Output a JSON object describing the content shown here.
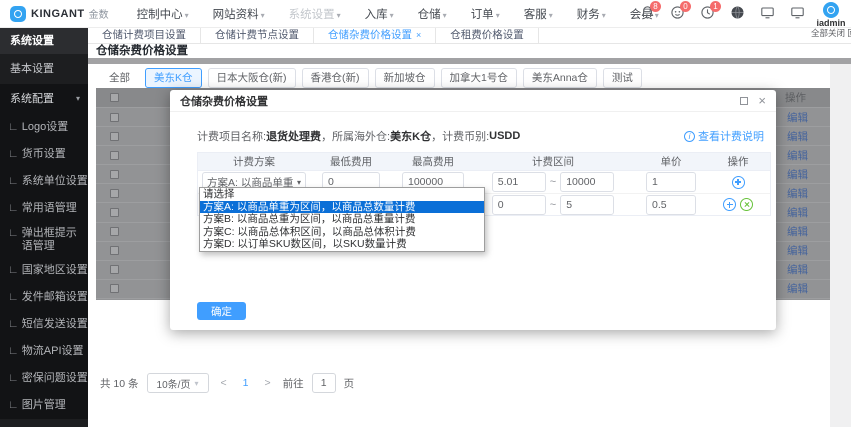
{
  "navbar": {
    "brand_name": "KINGANT",
    "brand_suffix": "金数",
    "menus": [
      "控制中心",
      "网站资料",
      "系统设置",
      "入库",
      "仓储",
      "订单",
      "客服",
      "财务",
      "会员"
    ],
    "badge_bell": "8",
    "badge_chat": "0",
    "badge_clock": "1",
    "username": "iadmin",
    "close_all": "全部关闭 回"
  },
  "sidebar": {
    "title": "系统设置",
    "items": [
      "基本设置",
      "系统配置",
      "Logo设置",
      "货币设置",
      "系统单位设置",
      "常用语管理",
      "弹出框提示语管理",
      "国家地区设置",
      "发件邮箱设置",
      "短信发送设置",
      "物流API设置",
      "密保问题设置",
      "图片管理"
    ]
  },
  "tabs": [
    "仓储计费项目设置",
    "仓储计费节点设置",
    "仓储杂费价格设置",
    "仓租费价格设置"
  ],
  "tab_close": "×",
  "page_title": "仓储杂费价格设置",
  "filters": [
    "全部",
    "美东K仓",
    "日本大阪仓(新)",
    "香港仓(新)",
    "新加坡仓",
    "加拿大1号仓",
    "美东Anna仓",
    "测试"
  ],
  "bg_table": {
    "op_header": "操作",
    "edit_links": [
      "编辑",
      "编辑",
      "编辑",
      "编辑",
      "编辑",
      "编辑",
      "编辑",
      "编辑",
      "编辑",
      "编辑"
    ]
  },
  "pagination": {
    "total": "共 10 条",
    "page_size": "10条/页",
    "prev": "<",
    "page": "1",
    "next": ">",
    "goto": "前往",
    "goto_value": "1",
    "unit": "页"
  },
  "modal": {
    "title": "仓储杂费价格设置",
    "info_l1": "计费项目名称: ",
    "info_v1": "退货处理费",
    "info_l2": "，所属海外仓: ",
    "info_v2": "美东K仓",
    "info_l3": "，计费币别: ",
    "info_v3": "USDD",
    "help_link": "查看计费说明",
    "headers": [
      "计费方案",
      "最低费用",
      "最高费用",
      "计费区间",
      "单价",
      "操作"
    ],
    "row1": {
      "plan": "方案A: 以商品单重",
      "min": "0",
      "max": "100000",
      "from": "5.01",
      "to": "10000",
      "price": "1"
    },
    "row2": {
      "from": "0",
      "to": "5",
      "price": "0.5"
    },
    "range_sep": "~",
    "dropdown": [
      "请选择",
      "方案A: 以商品单重为区间，以商品总数量计费",
      "方案B: 以商品总重为区间，以商品总重量计费",
      "方案C: 以商品总体积区间，以商品总体积计费",
      "方案D: 以订单SKU数区间，以SKU数量计费"
    ],
    "confirm": "确定"
  },
  "colors": {
    "accent": "#409eff",
    "badge_red": "#f56c6c",
    "success_green": "#67c23a",
    "dropdown_highlight": "#0b6fd7",
    "sidebar_bg": "#1d1e20"
  }
}
